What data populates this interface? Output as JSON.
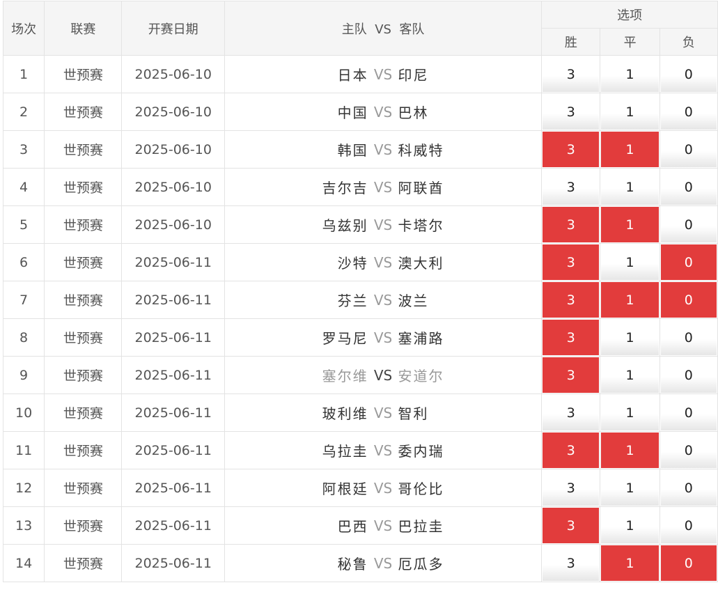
{
  "header": {
    "no": "场次",
    "league": "联赛",
    "date": "开赛日期",
    "home": "主队",
    "vs": "VS",
    "away": "客队",
    "options": "选项",
    "win": "胜",
    "draw": "平",
    "lose": "负"
  },
  "rows": [
    {
      "no": "1",
      "league": "世预赛",
      "date": "2025-06-10",
      "home": "日本",
      "vs": "VS",
      "away": "印尼",
      "win": "3",
      "draw": "1",
      "lose": "0",
      "win_sel": false,
      "draw_sel": false,
      "lose_sel": false
    },
    {
      "no": "2",
      "league": "世预赛",
      "date": "2025-06-10",
      "home": "中国",
      "vs": "VS",
      "away": "巴林",
      "win": "3",
      "draw": "1",
      "lose": "0",
      "win_sel": false,
      "draw_sel": false,
      "lose_sel": false
    },
    {
      "no": "3",
      "league": "世预赛",
      "date": "2025-06-10",
      "home": "韩国",
      "vs": "VS",
      "away": "科威特",
      "win": "3",
      "draw": "1",
      "lose": "0",
      "win_sel": true,
      "draw_sel": true,
      "lose_sel": false
    },
    {
      "no": "4",
      "league": "世预赛",
      "date": "2025-06-10",
      "home": "吉尔吉",
      "vs": "VS",
      "away": "阿联酋",
      "win": "3",
      "draw": "1",
      "lose": "0",
      "win_sel": false,
      "draw_sel": false,
      "lose_sel": false
    },
    {
      "no": "5",
      "league": "世预赛",
      "date": "2025-06-10",
      "home": "乌兹别",
      "vs": "VS",
      "away": "卡塔尔",
      "win": "3",
      "draw": "1",
      "lose": "0",
      "win_sel": true,
      "draw_sel": true,
      "lose_sel": false
    },
    {
      "no": "6",
      "league": "世预赛",
      "date": "2025-06-11",
      "home": "沙特",
      "vs": "VS",
      "away": "澳大利",
      "win": "3",
      "draw": "1",
      "lose": "0",
      "win_sel": true,
      "draw_sel": false,
      "lose_sel": true
    },
    {
      "no": "7",
      "league": "世预赛",
      "date": "2025-06-11",
      "home": "芬兰",
      "vs": "VS",
      "away": "波兰",
      "win": "3",
      "draw": "1",
      "lose": "0",
      "win_sel": true,
      "draw_sel": true,
      "lose_sel": true
    },
    {
      "no": "8",
      "league": "世预赛",
      "date": "2025-06-11",
      "home": "罗马尼",
      "vs": "VS",
      "away": "塞浦路",
      "win": "3",
      "draw": "1",
      "lose": "0",
      "win_sel": true,
      "draw_sel": false,
      "lose_sel": false
    },
    {
      "no": "9",
      "league": "世预赛",
      "date": "2025-06-11",
      "home": "塞尔维",
      "vs": "VS",
      "away": "安道尔",
      "win": "3",
      "draw": "1",
      "lose": "0",
      "win_sel": true,
      "draw_sel": false,
      "lose_sel": false,
      "dim": true
    },
    {
      "no": "10",
      "league": "世预赛",
      "date": "2025-06-11",
      "home": "玻利维",
      "vs": "VS",
      "away": "智利",
      "win": "3",
      "draw": "1",
      "lose": "0",
      "win_sel": false,
      "draw_sel": false,
      "lose_sel": false
    },
    {
      "no": "11",
      "league": "世预赛",
      "date": "2025-06-11",
      "home": "乌拉圭",
      "vs": "VS",
      "away": "委内瑞",
      "win": "3",
      "draw": "1",
      "lose": "0",
      "win_sel": true,
      "draw_sel": true,
      "lose_sel": false
    },
    {
      "no": "12",
      "league": "世预赛",
      "date": "2025-06-11",
      "home": "阿根廷",
      "vs": "VS",
      "away": "哥伦比",
      "win": "3",
      "draw": "1",
      "lose": "0",
      "win_sel": false,
      "draw_sel": false,
      "lose_sel": false
    },
    {
      "no": "13",
      "league": "世预赛",
      "date": "2025-06-11",
      "home": "巴西",
      "vs": "VS",
      "away": "巴拉圭",
      "win": "3",
      "draw": "1",
      "lose": "0",
      "win_sel": true,
      "draw_sel": false,
      "lose_sel": false
    },
    {
      "no": "14",
      "league": "世预赛",
      "date": "2025-06-11",
      "home": "秘鲁",
      "vs": "VS",
      "away": "厄瓜多",
      "win": "3",
      "draw": "1",
      "lose": "0",
      "win_sel": false,
      "draw_sel": true,
      "lose_sel": true
    }
  ],
  "colors": {
    "selected": "#e23c3c",
    "vs": "#999999"
  }
}
